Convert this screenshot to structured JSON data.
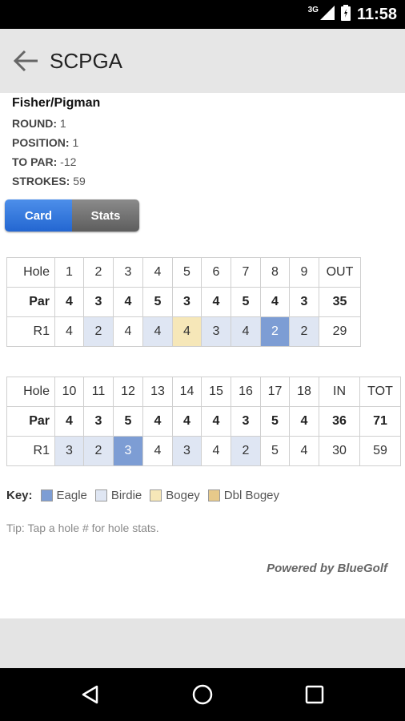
{
  "status_bar": {
    "network": "3G",
    "time": "11:58"
  },
  "app_bar": {
    "title": "SCPGA"
  },
  "player": {
    "name": "Fisher/Pigman",
    "info": [
      {
        "label": "ROUND:",
        "value": "1"
      },
      {
        "label": "POSITION:",
        "value": "1"
      },
      {
        "label": "TO PAR:",
        "value": "-12"
      },
      {
        "label": "STROKES:",
        "value": "59"
      }
    ]
  },
  "tabs": {
    "card": "Card",
    "stats": "Stats",
    "active": "card"
  },
  "front_nine": {
    "hole_label": "Hole",
    "par_label": "Par",
    "round_label": "R1",
    "holes": [
      "1",
      "2",
      "3",
      "4",
      "5",
      "6",
      "7",
      "8",
      "9"
    ],
    "total_label": "OUT",
    "par": [
      "4",
      "3",
      "4",
      "5",
      "3",
      "4",
      "5",
      "4",
      "3"
    ],
    "par_total": "35",
    "scores": [
      "4",
      "2",
      "4",
      "4",
      "4",
      "3",
      "4",
      "2",
      "2"
    ],
    "score_types": [
      "",
      "birdie",
      "",
      "birdie",
      "bogey",
      "birdie",
      "birdie",
      "eagle",
      "birdie"
    ],
    "score_total": "29"
  },
  "back_nine": {
    "hole_label": "Hole",
    "par_label": "Par",
    "round_label": "R1",
    "holes": [
      "10",
      "11",
      "12",
      "13",
      "14",
      "15",
      "16",
      "17",
      "18"
    ],
    "in_label": "IN",
    "tot_label": "TOT",
    "par": [
      "4",
      "3",
      "5",
      "4",
      "4",
      "4",
      "3",
      "5",
      "4"
    ],
    "par_in": "36",
    "par_tot": "71",
    "scores": [
      "3",
      "2",
      "3",
      "4",
      "3",
      "4",
      "2",
      "5",
      "4"
    ],
    "score_types": [
      "birdie",
      "birdie",
      "eagle",
      "",
      "birdie",
      "",
      "birdie",
      "",
      ""
    ],
    "score_in": "30",
    "score_tot": "59"
  },
  "key": {
    "label": "Key:",
    "items": [
      {
        "name": "Eagle",
        "color": "#7d9dd4"
      },
      {
        "name": "Birdie",
        "color": "#dfe6f3"
      },
      {
        "name": "Bogey",
        "color": "#f6e7b8"
      },
      {
        "name": "Dbl Bogey",
        "color": "#e7c98a"
      }
    ]
  },
  "tip": "Tip: Tap a hole # for hole stats.",
  "powered_by": "Powered by BlueGolf"
}
